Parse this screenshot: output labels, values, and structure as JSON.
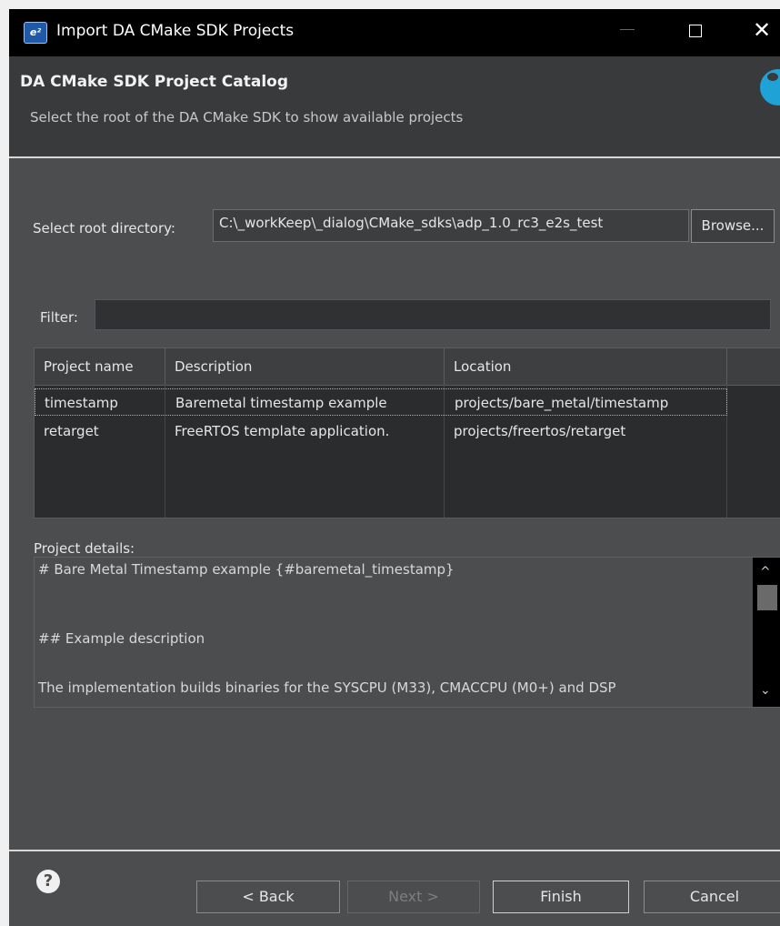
{
  "window": {
    "app_icon": "e²",
    "title": "Import DA CMake SDK Projects",
    "close_glyph": "✕"
  },
  "banner": {
    "title": "DA CMake SDK Project Catalog",
    "subtitle": "Select the root of the DA CMake SDK to show available projects"
  },
  "root": {
    "label": "Select root directory:",
    "value": "C:\\_workKeep\\_dialog\\CMake_sdks\\adp_1.0_rc3_e2s_test",
    "browse_label": "Browse..."
  },
  "filter": {
    "label": "Filter:",
    "value": ""
  },
  "table": {
    "columns": [
      "Project name",
      "Description",
      "Location"
    ],
    "rows": [
      {
        "name": "timestamp",
        "description": "Baremetal timestamp example",
        "location": "projects/bare_metal/timestamp"
      },
      {
        "name": "retarget",
        "description": "FreeRTOS template application.",
        "location": "projects/freertos/retarget"
      }
    ]
  },
  "details": {
    "label": "Project details:",
    "lines": [
      "# Bare Metal Timestamp example {#baremetal_timestamp}",
      "## Example description",
      "The implementation builds binaries for the SYSCPU (M33), CMACCPU (M0+) and DSP"
    ],
    "scroll_up": "^",
    "scroll_down": "⌄"
  },
  "footer": {
    "help": "?",
    "back_label": "< Back",
    "next_label": "Next >",
    "finish_label": "Finish",
    "cancel_label": "Cancel"
  }
}
